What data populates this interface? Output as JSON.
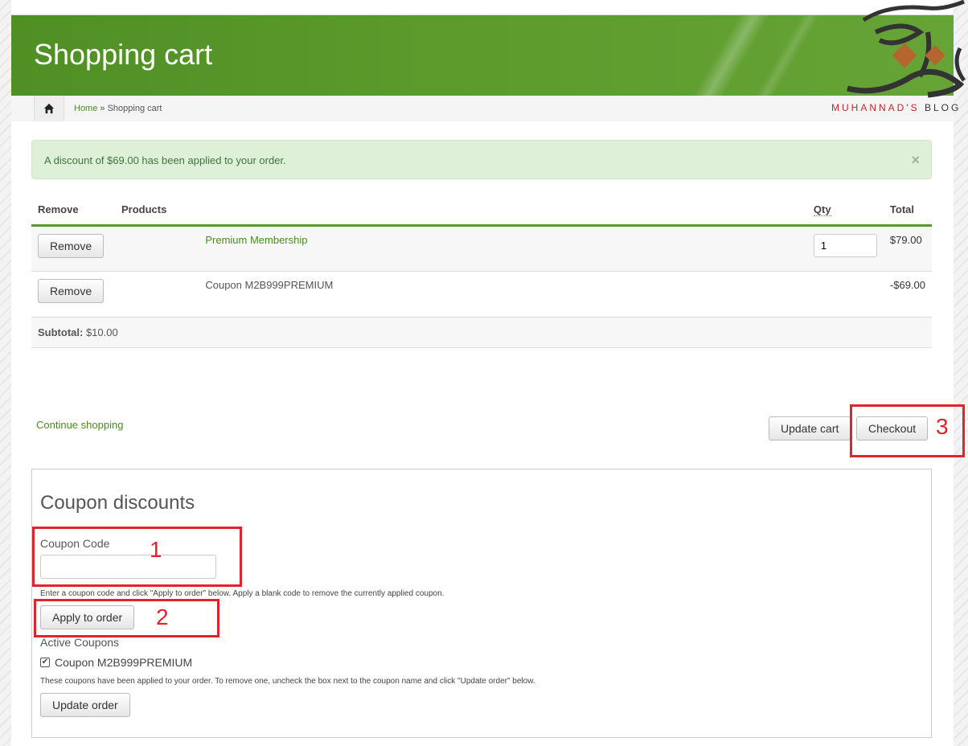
{
  "header": {
    "title": "Shopping cart"
  },
  "breadcrumb": {
    "home": "Home",
    "separator": "»",
    "current": "Shopping cart"
  },
  "alert": {
    "message": "A discount of $69.00 has been applied to your order.",
    "close": "×"
  },
  "cart": {
    "headers": {
      "remove": "Remove",
      "products": "Products",
      "qty": "Qty",
      "total": "Total"
    },
    "rows": [
      {
        "remove_label": "Remove",
        "product": "Premium Membership",
        "qty": "1",
        "total": "$79.00"
      },
      {
        "remove_label": "Remove",
        "product": "Coupon M2B999PREMIUM",
        "qty": "",
        "total": "-$69.00"
      }
    ],
    "subtotal_label": "Subtotal:",
    "subtotal_value": "$10.00"
  },
  "actions": {
    "continue_shopping": "Continue shopping",
    "update_cart": "Update cart",
    "checkout": "Checkout"
  },
  "coupon": {
    "title": "Coupon discounts",
    "code_label": "Coupon Code",
    "code_value": "",
    "help": "Enter a coupon code and click \"Apply to order\" below. Apply a blank code to remove the currently applied coupon.",
    "apply_button": "Apply to order",
    "active_label": "Active Coupons",
    "active_coupon": "Coupon M2B999PREMIUM",
    "active_checked": true,
    "active_help": "These coupons have been applied to your order. To remove one, uncheck the box next to the coupon name and click \"Update order\" below.",
    "update_button": "Update order"
  },
  "annotations": {
    "one": "1",
    "two": "2",
    "three": "3"
  },
  "watermark": {
    "part1": "MUHANNAD'S",
    "part2": "BLOG"
  },
  "colors": {
    "header_green": "#5c9a2c",
    "link_green": "#4a8a1f",
    "annotation_red": "#e1232b",
    "alert_bg": "#dff0d8"
  }
}
